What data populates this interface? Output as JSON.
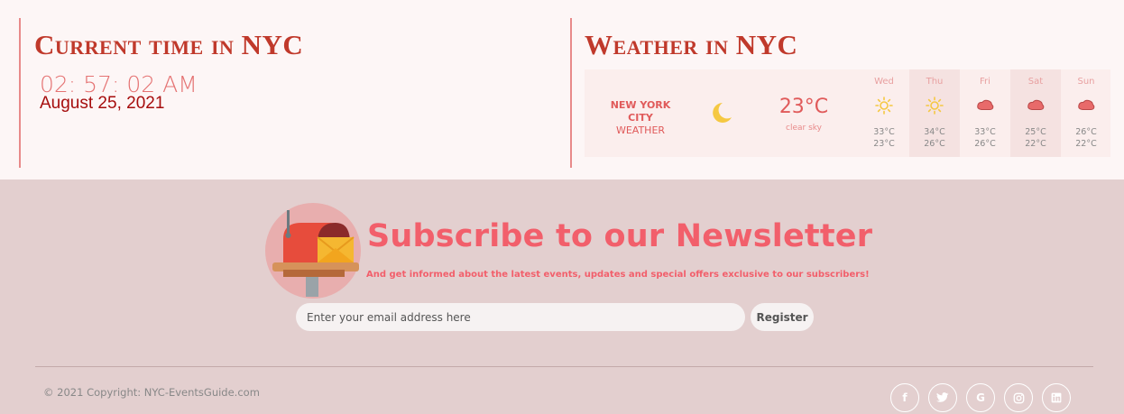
{
  "time_section": {
    "title": "Current time in NYC",
    "clock": "02: 57: 02 AM",
    "date": "August 25, 2021"
  },
  "weather_section": {
    "title": "Weather in NYC",
    "city": "NEW YORK CITY",
    "city_sub": "WEATHER",
    "current_icon": "crescent-moon-icon",
    "temperature": "23°C",
    "description": "clear sky",
    "forecast": [
      {
        "day": "Wed",
        "icon": "sun-icon",
        "high": "33°C",
        "low": "23°C"
      },
      {
        "day": "Thu",
        "icon": "sun-icon",
        "high": "34°C",
        "low": "26°C"
      },
      {
        "day": "Fri",
        "icon": "cloud-icon",
        "high": "33°C",
        "low": "26°C"
      },
      {
        "day": "Sat",
        "icon": "cloud-icon",
        "high": "25°C",
        "low": "22°C"
      },
      {
        "day": "Sun",
        "icon": "cloud-icon",
        "high": "26°C",
        "low": "22°C"
      }
    ]
  },
  "newsletter": {
    "title": "Subscribe to our Newsletter",
    "subtitle": "And get informed about the latest events, updates and special offers exclusive to our subscribers!",
    "email_placeholder": "Enter your email address here",
    "register_label": "Register"
  },
  "footer": {
    "copyright": "© 2021 Copyright: NYC-EventsGuide.com",
    "socials": [
      {
        "name": "facebook-icon",
        "glyph": "f"
      },
      {
        "name": "twitter-icon",
        "glyph": "🐦"
      },
      {
        "name": "google-icon",
        "glyph": "G"
      },
      {
        "name": "instagram-icon",
        "glyph": "◎"
      },
      {
        "name": "linkedin-icon",
        "glyph": "in"
      }
    ]
  },
  "colors": {
    "accent": "#c0392b",
    "headline": "#f25f6b",
    "footer_bg": "#e3cfcf",
    "page_bg": "#fdf6f6"
  }
}
